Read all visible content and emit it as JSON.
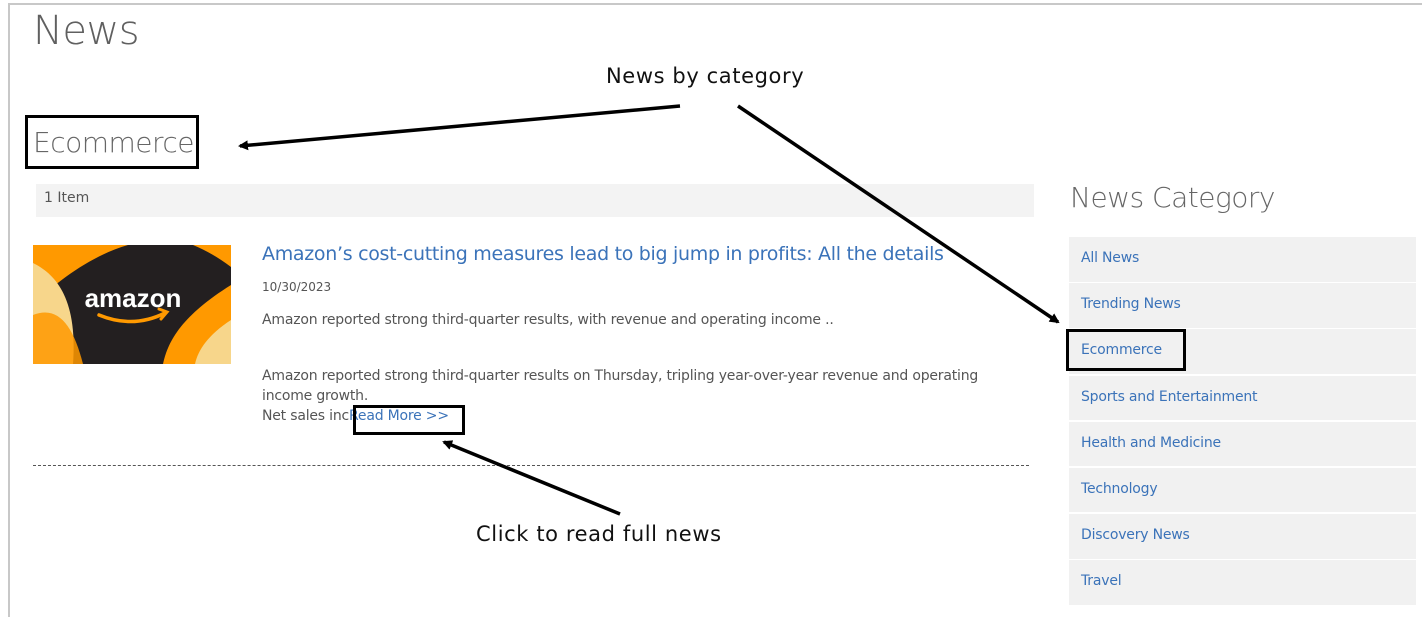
{
  "page": {
    "title": "News"
  },
  "category_heading": "Ecommerce",
  "item_count": "1 Item",
  "article": {
    "image_brand": "amazon",
    "title": "Amazon’s cost-cutting measures lead to big jump in profits: All the details",
    "date": "10/30/2023",
    "summary": "Amazon reported strong third-quarter results, with revenue and operating income  ..",
    "body_line1": "Amazon reported strong third-quarter results on Thursday, tripling year-over-year revenue and operating",
    "body_line2": "income growth.",
    "body_line3_prefix": "Net sales inc",
    "read_more": "Read More >>"
  },
  "sidebar": {
    "title": "News Category",
    "active": "Ecommerce",
    "items": [
      {
        "label": "All News"
      },
      {
        "label": "Trending News"
      },
      {
        "label": "Ecommerce"
      },
      {
        "label": "Sports and Entertainment"
      },
      {
        "label": "Health and Medicine"
      },
      {
        "label": "Technology"
      },
      {
        "label": "Discovery News"
      },
      {
        "label": "Travel"
      }
    ]
  },
  "annotations": {
    "top": "News by category",
    "bottom": "Click to read full news"
  },
  "colors": {
    "link": "#3b73b9",
    "text": "#555555",
    "heading": "#666666",
    "amazon_orange": "#ff9900",
    "amazon_dark": "#231f20"
  }
}
